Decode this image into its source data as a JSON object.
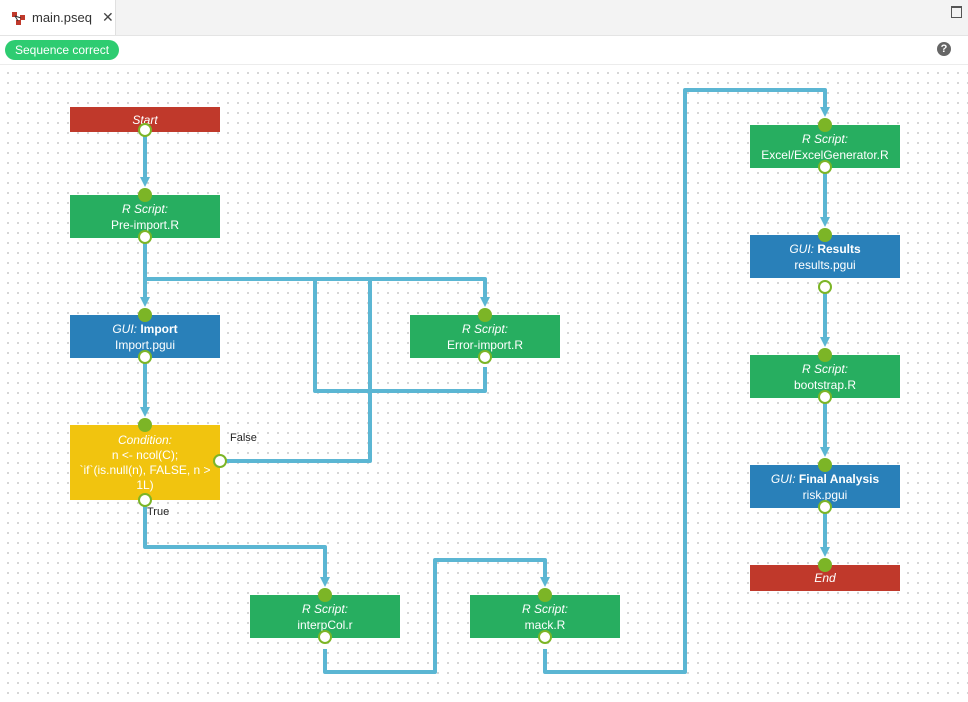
{
  "tab": {
    "label": "main.pseq",
    "close": "✕"
  },
  "toolbar": {
    "status": "Sequence correct",
    "help": "?"
  },
  "nodes": {
    "start": {
      "label": "Start"
    },
    "pre_import": {
      "kind": "R Script:",
      "file": "Pre-import.R"
    },
    "import": {
      "kind": "GUI:",
      "name": "Import",
      "file": "Import.pgui"
    },
    "error_import": {
      "kind": "R Script:",
      "file": "Error-import.R"
    },
    "condition": {
      "kind": "Condition:",
      "line1": "n <- ncol(C);",
      "line2": "`if`(is.null(n), FALSE, n >",
      "line3": "1L)"
    },
    "interpcol": {
      "kind": "R Script:",
      "file": "interpCol.r"
    },
    "mack": {
      "kind": "R Script:",
      "file": "mack.R"
    },
    "excel": {
      "kind": "R Script:",
      "file": "Excel/ExcelGenerator.R"
    },
    "results": {
      "kind": "GUI:",
      "name": "Results",
      "file": "results.pgui"
    },
    "bootstrap": {
      "kind": "R Script:",
      "file": "bootstrap.R"
    },
    "final": {
      "kind": "GUI:",
      "name": "Final Analysis",
      "file": "risk.pgui"
    },
    "end": {
      "label": "End"
    }
  },
  "branches": {
    "false_label": "False",
    "true_label": "True"
  },
  "colors": {
    "terminal": "#c0392b",
    "r_script": "#27ae60",
    "gui": "#2980b9",
    "condition": "#f1c40f",
    "edge": "#5bb6d3",
    "port": "#7cb526",
    "status_badge": "#2ecc71"
  },
  "icons": {
    "tab": "workflow-icon",
    "close": "close-icon",
    "maximize": "maximize-icon",
    "help": "help-icon"
  }
}
